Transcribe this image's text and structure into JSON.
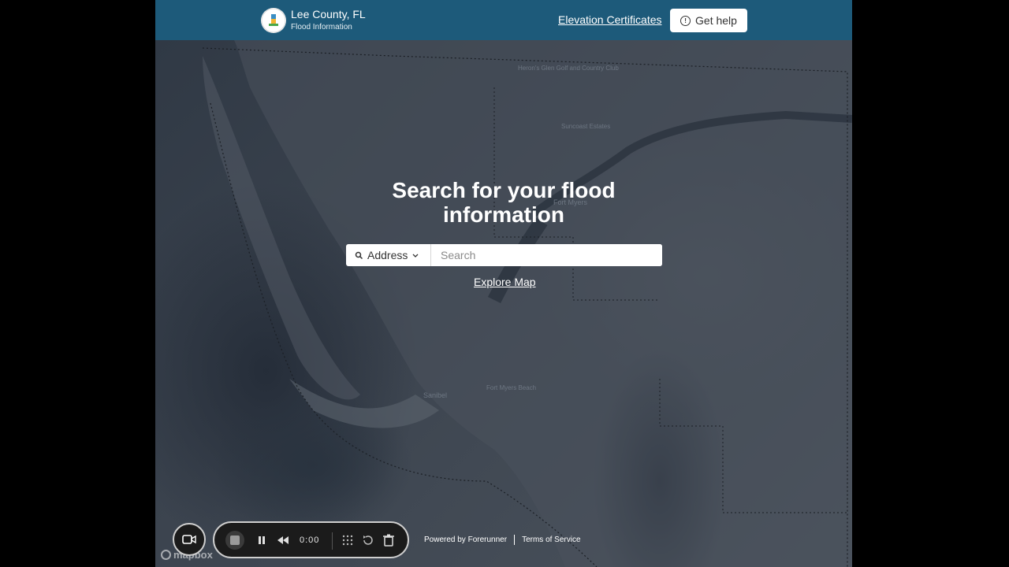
{
  "header": {
    "brand_title": "Lee County, FL",
    "brand_subtitle": "Flood Information",
    "elevation_link": "Elevation Certificates",
    "help_button": "Get help",
    "header_color": "#1d5a7a"
  },
  "map": {
    "labels": [
      "Fort Myers",
      "Sanibel",
      "Fort Myers Beach",
      "Heron's Glen Golf and Country Club",
      "Suncoast Estates"
    ],
    "attribution": "mapbox"
  },
  "search": {
    "title": "Search for your flood information",
    "type_select": "Address",
    "placeholder": "Search",
    "explore_link": "Explore Map"
  },
  "footer": {
    "powered_by": "Powered by Forerunner",
    "terms": "Terms of Service"
  },
  "recorder": {
    "time": "0:00"
  }
}
